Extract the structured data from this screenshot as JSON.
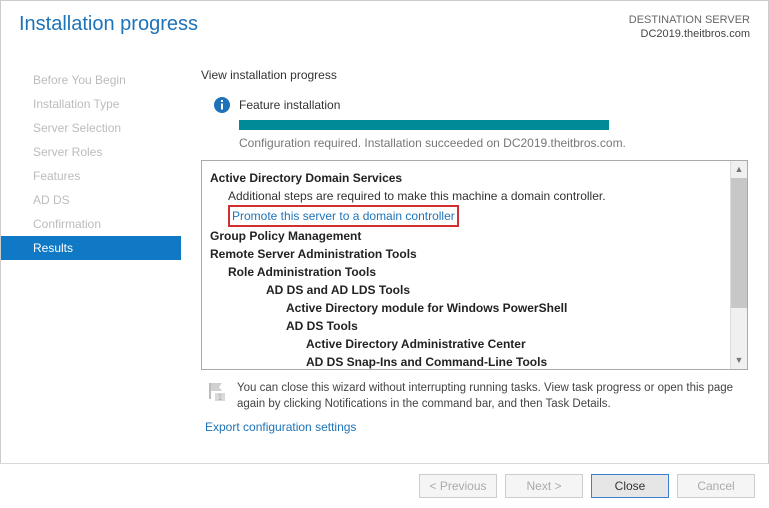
{
  "header": {
    "title": "Installation progress",
    "dest_label": "DESTINATION SERVER",
    "dest_value": "DC2019.theitbros.com"
  },
  "sidebar": {
    "items": [
      {
        "label": "Before You Begin"
      },
      {
        "label": "Installation Type"
      },
      {
        "label": "Server Selection"
      },
      {
        "label": "Server Roles"
      },
      {
        "label": "Features"
      },
      {
        "label": "AD DS"
      },
      {
        "label": "Confirmation"
      },
      {
        "label": "Results"
      }
    ]
  },
  "content": {
    "view_title": "View installation progress",
    "feature_label": "Feature installation",
    "status_text": "Configuration required. Installation succeeded on DC2019.theitbros.com.",
    "results": {
      "adds_title": "Active Directory Domain Services",
      "adds_note": "Additional steps are required to make this machine a domain controller.",
      "adds_link": "Promote this server to a domain controller",
      "gpm": "Group Policy Management",
      "rsat": "Remote Server Administration Tools",
      "rat": "Role Administration Tools",
      "adlds": "AD DS and AD LDS Tools",
      "admodule": "Active Directory module for Windows PowerShell",
      "adtools": "AD DS Tools",
      "adcenter": "Active Directory Administrative Center",
      "adsnapins": "AD DS Snap-Ins and Command-Line Tools"
    },
    "note": "You can close this wizard without interrupting running tasks. View task progress or open this page again by clicking Notifications in the command bar, and then Task Details.",
    "export_link": "Export configuration settings"
  },
  "footer": {
    "previous": "< Previous",
    "next": "Next >",
    "close": "Close",
    "cancel": "Cancel"
  }
}
